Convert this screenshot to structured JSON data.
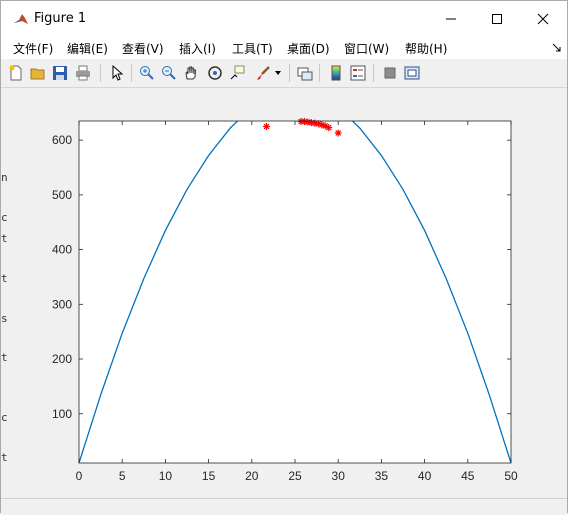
{
  "window": {
    "title": "Figure 1"
  },
  "menu": [
    "文件(F)",
    "编辑(E)",
    "查看(V)",
    "插入(I)",
    "工具(T)",
    "桌面(D)",
    "窗口(W)",
    "帮助(H)"
  ],
  "toolbar_icons": [
    "new-figure-icon",
    "open-file-icon",
    "save-icon",
    "print-icon",
    "pointer-icon",
    "zoom-in-icon",
    "zoom-out-icon",
    "pan-icon",
    "rotate-3d-icon",
    "data-cursor-icon",
    "brush-icon",
    "dropdown-arrow-icon",
    "link-plot-icon",
    "colorbar-icon",
    "legend-icon",
    "hide-plot-tools-icon",
    "show-plot-tools-icon"
  ],
  "chart_data": {
    "type": "line",
    "xlim": [
      0,
      50
    ],
    "ylim": [
      10,
      635
    ],
    "xticks": [
      "0",
      "5",
      "10",
      "15",
      "20",
      "25",
      "30",
      "35",
      "40",
      "45",
      "50"
    ],
    "yticks": [
      "100",
      "200",
      "300",
      "400",
      "500",
      "600"
    ],
    "series": [
      {
        "type": "line",
        "color": "#0072bd",
        "x": [
          0,
          2.5,
          5,
          7.5,
          10,
          12.5,
          15,
          17.5,
          20,
          22.5,
          25,
          27.5,
          30,
          32.5,
          35,
          37.5,
          40,
          42.5,
          45,
          47.5,
          50
        ],
        "y": [
          10,
          134,
          247,
          347,
          435,
          510,
          572,
          622,
          660,
          685,
          697,
          685,
          660,
          622,
          572,
          510,
          435,
          347,
          247,
          134,
          10
        ]
      },
      {
        "type": "scatter",
        "color": "#ff0000",
        "marker": "*",
        "x": [
          21.7,
          25.7,
          26.1,
          26.5,
          26.9,
          27.3,
          27.7,
          28.1,
          28.5,
          28.9,
          30.0
        ],
        "y": [
          625,
          634,
          634,
          633,
          632,
          631,
          630,
          628,
          626,
          623,
          613
        ]
      }
    ]
  },
  "gutter_letters": [
    "n",
    "c",
    "t",
    "t",
    "s",
    "t",
    "c",
    "t"
  ]
}
